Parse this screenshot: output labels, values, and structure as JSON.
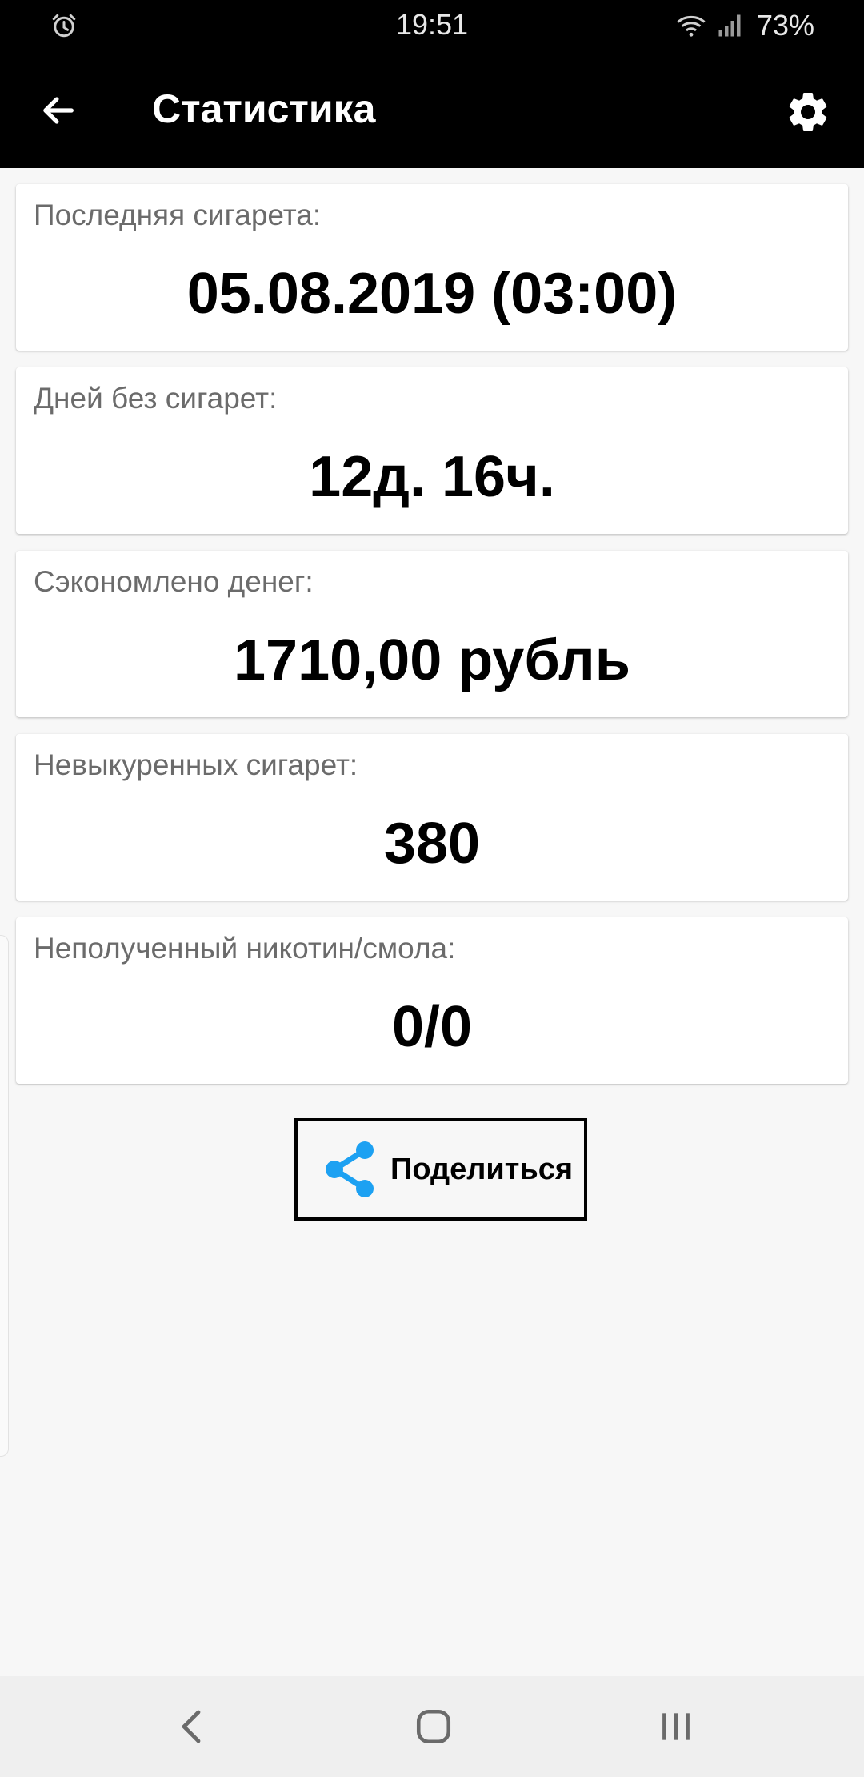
{
  "status_bar": {
    "time": "19:51",
    "battery": "73%",
    "icons": [
      "alarm-icon",
      "wifi-icon",
      "signal-icon"
    ]
  },
  "app_bar": {
    "title": "Статистика",
    "back_icon": "arrow-left-icon",
    "settings_icon": "gear-icon"
  },
  "stats": [
    {
      "label": "Последняя сигарета:",
      "value": "05.08.2019 (03:00)"
    },
    {
      "label": "Дней без сигарет:",
      "value": "12д. 16ч."
    },
    {
      "label": "Сэкономлено денег:",
      "value": "1710,00 рубль"
    },
    {
      "label": "Невыкуренных сигарет:",
      "value": "380"
    },
    {
      "label": "Неполученный никотин/смола:",
      "value": "0/0"
    }
  ],
  "share": {
    "label": "Поделиться",
    "icon": "share-icon"
  },
  "colors": {
    "app_bar_background": "#000000",
    "content_background": "#f7f7f7",
    "card_background": "#ffffff",
    "label_text": "#6b6b6b",
    "share_icon": "#1da1f2"
  },
  "nav_bar": {
    "icons": [
      "nav-back-icon",
      "nav-home-icon",
      "nav-recents-icon"
    ]
  }
}
